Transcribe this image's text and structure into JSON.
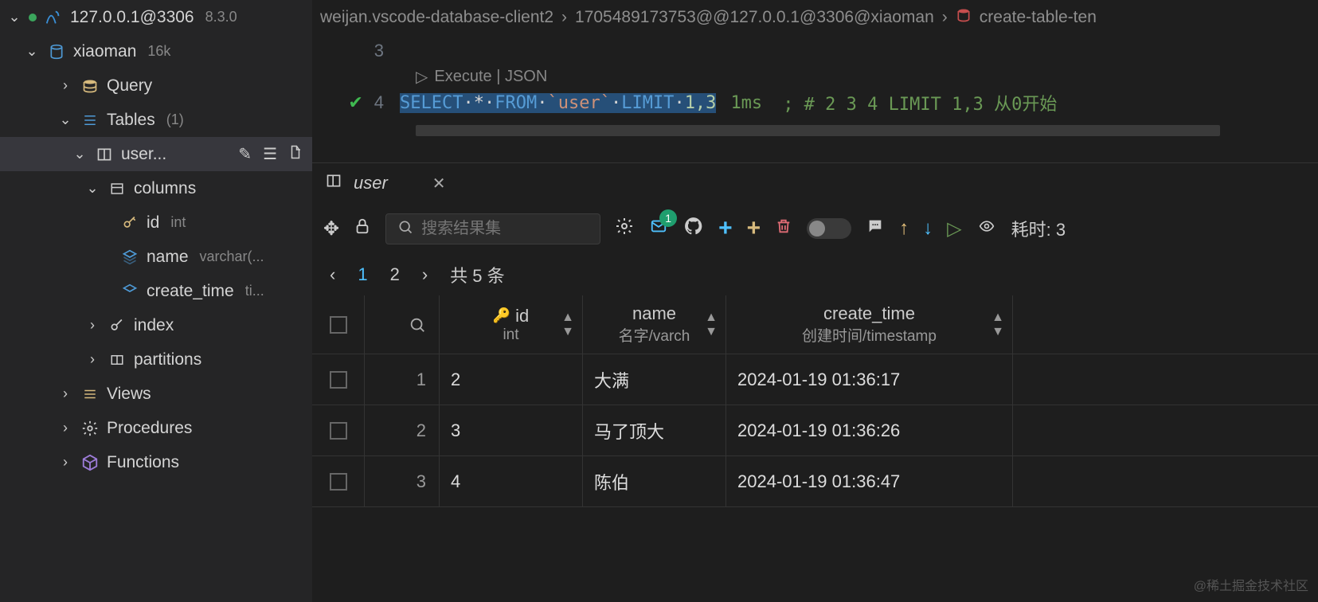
{
  "sidebar": {
    "connection": {
      "host": "127.0.0.1@3306",
      "version": "8.3.0"
    },
    "database": {
      "name": "xiaoman",
      "count": "16k"
    },
    "query": "Query",
    "tables": {
      "label": "Tables",
      "count": "(1)"
    },
    "table_user": "user...",
    "columns_label": "columns",
    "cols": {
      "id": {
        "name": "id",
        "type": "int"
      },
      "name": {
        "name": "name",
        "type": "varchar(..."
      },
      "create_time": {
        "name": "create_time",
        "type": "ti..."
      }
    },
    "index": "index",
    "partitions": "partitions",
    "views": "Views",
    "procedures": "Procedures",
    "functions": "Functions"
  },
  "breadcrumb": {
    "a": "weijan.vscode-database-client2",
    "b": "1705489173753@@127.0.0.1@3306@xiaoman",
    "c": "create-table-ten"
  },
  "editor": {
    "line3": "3",
    "line4": "4",
    "codelens": "Execute | JSON",
    "sql_select": "SELECT",
    "sql_star": "*",
    "sql_from": "FROM",
    "sql_table": "`user`",
    "sql_limit": "LIMIT",
    "sql_args": "1,3",
    "exec_time": "1ms",
    "comment": ";  # 2 3 4   LIMIT 1,3  从0开始"
  },
  "panel": {
    "tab": "user",
    "search_placeholder": "搜索结果集",
    "mail_badge": "1",
    "elapsed_label": "耗时: 3",
    "pager": {
      "p1": "1",
      "p2": "2",
      "total": "共 5 条"
    },
    "headers": {
      "id": {
        "name": "id",
        "type": "int"
      },
      "name": {
        "name": "name",
        "type": "名字/varch"
      },
      "create_time": {
        "name": "create_time",
        "type": "创建时间/timestamp"
      }
    },
    "rows": [
      {
        "idx": "1",
        "id": "2",
        "name": "大满",
        "create_time": "2024-01-19 01:36:17"
      },
      {
        "idx": "2",
        "id": "3",
        "name": "马了顶大",
        "create_time": "2024-01-19 01:36:26"
      },
      {
        "idx": "3",
        "id": "4",
        "name": "陈伯",
        "create_time": "2024-01-19 01:36:47"
      }
    ]
  },
  "watermark": "@稀土掘金技术社区"
}
